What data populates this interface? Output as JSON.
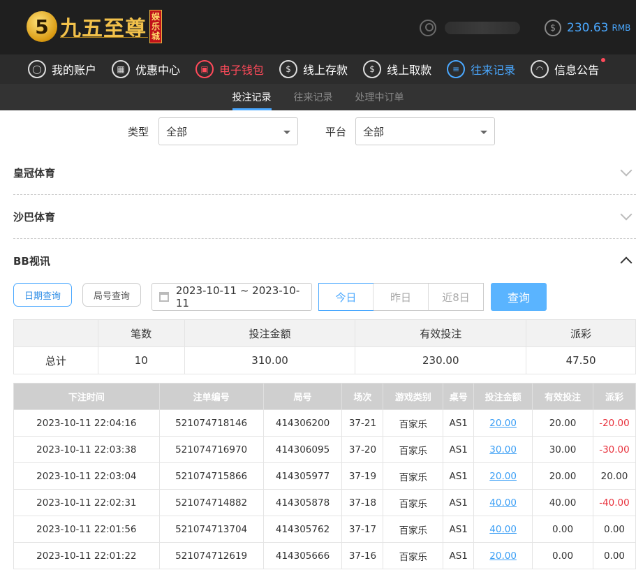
{
  "header": {
    "logo_char": "5",
    "logo_text": "九五至尊",
    "logo_tag": "娱乐城",
    "balance_icon": "dollar-icon",
    "balance": "230.63",
    "currency": "RMB"
  },
  "nav": [
    {
      "label": "我的账户",
      "icon": "user-icon",
      "glyph": "◯"
    },
    {
      "label": "优惠中心",
      "icon": "gift-icon",
      "glyph": "▦"
    },
    {
      "label": "电子钱包",
      "icon": "wallet-icon",
      "glyph": "▣"
    },
    {
      "label": "线上存款",
      "icon": "deposit-icon",
      "glyph": "$"
    },
    {
      "label": "线上取款",
      "icon": "withdraw-icon",
      "glyph": "$"
    },
    {
      "label": "往来记录",
      "icon": "record-icon",
      "glyph": "≡"
    },
    {
      "label": "信息公告",
      "icon": "bell-icon",
      "glyph": "◠"
    }
  ],
  "subtabs": [
    "投注记录",
    "往来记录",
    "处理中订单"
  ],
  "filters": {
    "type_label": "类型",
    "type_value": "全部",
    "platform_label": "平台",
    "platform_value": "全部"
  },
  "sections": [
    "皇冠体育",
    "沙巴体育",
    "BB视讯"
  ],
  "query": {
    "date_query": "日期查询",
    "round_query": "局号查询",
    "date_range": "2023-10-11 ~ 2023-10-11",
    "today": "今日",
    "yesterday": "昨日",
    "last8": "近8日",
    "search": "查询"
  },
  "summary": {
    "headers": [
      "",
      "笔数",
      "投注金额",
      "有效投注",
      "派彩"
    ],
    "row": [
      "总计",
      "10",
      "310.00",
      "230.00",
      "47.50"
    ]
  },
  "bets": {
    "headers": [
      "下注时间",
      "注单编号",
      "局号",
      "场次",
      "游戏类别",
      "桌号",
      "投注金额",
      "有效投注",
      "派彩"
    ],
    "rows": [
      [
        "2023-10-11 22:04:16",
        "521074718146",
        "414306200",
        "37-21",
        "百家乐",
        "AS1",
        "20.00",
        "20.00",
        "-20.00"
      ],
      [
        "2023-10-11 22:03:38",
        "521074716970",
        "414306095",
        "37-20",
        "百家乐",
        "AS1",
        "30.00",
        "30.00",
        "-30.00"
      ],
      [
        "2023-10-11 22:03:04",
        "521074715866",
        "414305977",
        "37-19",
        "百家乐",
        "AS1",
        "20.00",
        "20.00",
        "20.00"
      ],
      [
        "2023-10-11 22:02:31",
        "521074714882",
        "414305878",
        "37-18",
        "百家乐",
        "AS1",
        "40.00",
        "40.00",
        "-40.00"
      ],
      [
        "2023-10-11 22:01:56",
        "521074713704",
        "414305762",
        "37-17",
        "百家乐",
        "AS1",
        "40.00",
        "0.00",
        "0.00"
      ],
      [
        "2023-10-11 22:01:22",
        "521074712619",
        "414305666",
        "37-16",
        "百家乐",
        "AS1",
        "20.00",
        "0.00",
        "0.00"
      ]
    ]
  },
  "colors": {
    "accent": "#4aa8ff",
    "active_nav": "#ff4a5a",
    "negative": "#e8313c"
  }
}
